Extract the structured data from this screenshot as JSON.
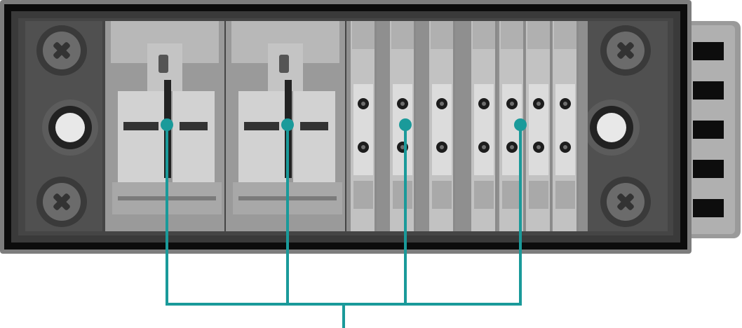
{
  "colors": {
    "background": "#ffffff",
    "housing_outer": "#7a7a7a",
    "housing_frame": "#0c0c0c",
    "housing_inner": "#3c3c3c",
    "terminal_light": "#c9c9c9",
    "terminal_mid": "#b3b3b3",
    "terminal_dark": "#8d8d8d",
    "heatsink": "#9a9a9a",
    "callout": "#1a9a9a"
  },
  "icons": {
    "screw": "cross-head-screw-icon",
    "mount": "mounting-hole-icon"
  },
  "components": {
    "power_terminals": 2,
    "signal_terminal_columns": 7,
    "corner_screws": 4,
    "mounting_holes": 2,
    "heatsink_fins": 5
  },
  "callout": {
    "markers": 4,
    "branches": 1
  }
}
